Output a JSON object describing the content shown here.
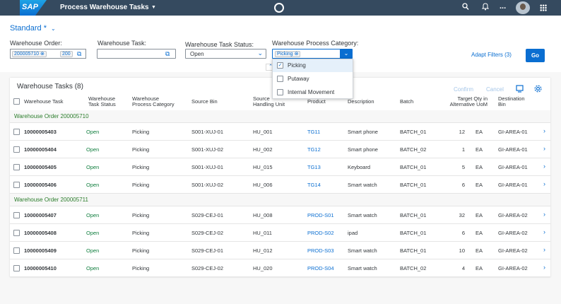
{
  "shell": {
    "logo_text": "SAP",
    "app_title": "Process Warehouse Tasks",
    "more_label": "..."
  },
  "header": {
    "variant_label": "Standard *",
    "filters": {
      "warehouse_order_label": "Warehouse Order:",
      "warehouse_order_token": "200005710",
      "warehouse_order_second": "200",
      "warehouse_task_label": "Warehouse Task:",
      "warehouse_task_value": "",
      "status_label": "Warehouse Task Status:",
      "status_value": "Open",
      "category_label": "Warehouse Process Category:",
      "category_token": "Picking"
    },
    "adapt_filters": "Adapt Filters (3)",
    "go_label": "Go"
  },
  "category_dropdown": {
    "options": [
      {
        "label": "Picking",
        "checked": true
      },
      {
        "label": "Putaway",
        "checked": false
      },
      {
        "label": "Internal Movement",
        "checked": false
      }
    ]
  },
  "table": {
    "title": "Warehouse Tasks (8)",
    "confirm_label": "Confirm",
    "cancel_label": "Cancel",
    "columns": {
      "task": "Warehouse Task",
      "status": [
        "Warehouse",
        "Task Status"
      ],
      "category": [
        "Warehouse",
        "Process Category"
      ],
      "source_bin": "Source Bin",
      "source_hu": [
        "Source",
        "Handling Unit"
      ],
      "product": "Product",
      "description": "Description",
      "batch": "Batch",
      "target_qty": [
        "Target Qty in",
        "Alternative UoM"
      ],
      "dest_bin": [
        "Destination",
        "Bin"
      ]
    },
    "groups": [
      {
        "label": "Warehouse Order 200005710",
        "rows": [
          {
            "task": "10000005403",
            "status": "Open",
            "category": "Picking",
            "source_bin": "S001-XUJ-01",
            "hu": "HU_001",
            "product": "TG11",
            "description": "Smart phone",
            "batch": "BATCH_01",
            "qty": "12",
            "uom": "EA",
            "dest": "GI-AREA-01"
          },
          {
            "task": "10000005404",
            "status": "Open",
            "category": "Picking",
            "source_bin": "S001-XUJ-02",
            "hu": "HU_002",
            "product": "TG12",
            "description": "Smart phone",
            "batch": "BATCH_02",
            "qty": "1",
            "uom": "EA",
            "dest": "GI-AREA-01"
          },
          {
            "task": "10000005405",
            "status": "Open",
            "category": "Picking",
            "source_bin": "S001-XUJ-01",
            "hu": "HU_015",
            "product": "TG13",
            "description": "Keyboard",
            "batch": "BATCH_01",
            "qty": "5",
            "uom": "EA",
            "dest": "GI-AREA-01"
          },
          {
            "task": "10000005406",
            "status": "Open",
            "category": "Picking",
            "source_bin": "S001-XUJ-02",
            "hu": "HU_006",
            "product": "TG14",
            "description": "Smart watch",
            "batch": "BATCH_01",
            "qty": "6",
            "uom": "EA",
            "dest": "GI-AREA-01"
          }
        ]
      },
      {
        "label": "Warehouse Order 200005711",
        "rows": [
          {
            "task": "10000005407",
            "status": "Open",
            "category": "Picking",
            "source_bin": "S029-CEJ-01",
            "hu": "HU_008",
            "product": "PROD-S01",
            "description": "Smart watch",
            "batch": "BATCH_01",
            "qty": "32",
            "uom": "EA",
            "dest": "GI-AREA-02"
          },
          {
            "task": "10000005408",
            "status": "Open",
            "category": "Picking",
            "source_bin": "S029-CEJ-02",
            "hu": "HU_011",
            "product": "PROD-S02",
            "description": "ipad",
            "batch": "BATCH_01",
            "qty": "6",
            "uom": "EA",
            "dest": "GI-AREA-02"
          },
          {
            "task": "10000005409",
            "status": "Open",
            "category": "Picking",
            "source_bin": "S029-CEJ-01",
            "hu": "HU_012",
            "product": "PROD-S03",
            "description": "Smart watch",
            "batch": "BATCH_01",
            "qty": "10",
            "uom": "EA",
            "dest": "GI-AREA-02"
          },
          {
            "task": "10000005410",
            "status": "Open",
            "category": "Picking",
            "source_bin": "S029-CEJ-02",
            "hu": "HU_020",
            "product": "PROD-S04",
            "description": "Smart watch",
            "batch": "BATCH_02",
            "qty": "4",
            "uom": "EA",
            "dest": "GI-AREA-02"
          }
        ]
      }
    ]
  }
}
